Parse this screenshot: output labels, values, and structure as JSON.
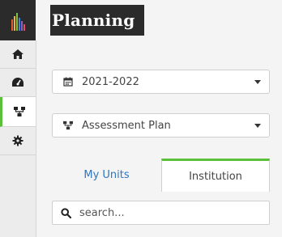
{
  "header": {
    "title": "Planning"
  },
  "colors": {
    "accent": "#5bbf3a",
    "link": "#2f75c2",
    "header_bg": "#2b2b2b",
    "logo_bars": [
      "#e35a2c",
      "#f2b233",
      "#7cc04b",
      "#3f86d6",
      "#9a5bc2",
      "#e54b6e"
    ]
  },
  "sidebar": {
    "items": [
      {
        "icon": "home-icon",
        "active": false
      },
      {
        "icon": "dashboard-icon",
        "active": false
      },
      {
        "icon": "hierarchy-icon",
        "active": true
      },
      {
        "icon": "gear-icon",
        "active": false
      }
    ]
  },
  "filters": {
    "year": {
      "value": "2021-2022",
      "icon": "calendar-icon"
    },
    "plan": {
      "value": "Assessment Plan",
      "icon": "hierarchy-icon"
    }
  },
  "tabs": [
    {
      "label": "My Units",
      "active": false
    },
    {
      "label": "Institution",
      "active": true
    }
  ],
  "search": {
    "placeholder": "search...",
    "value": ""
  }
}
